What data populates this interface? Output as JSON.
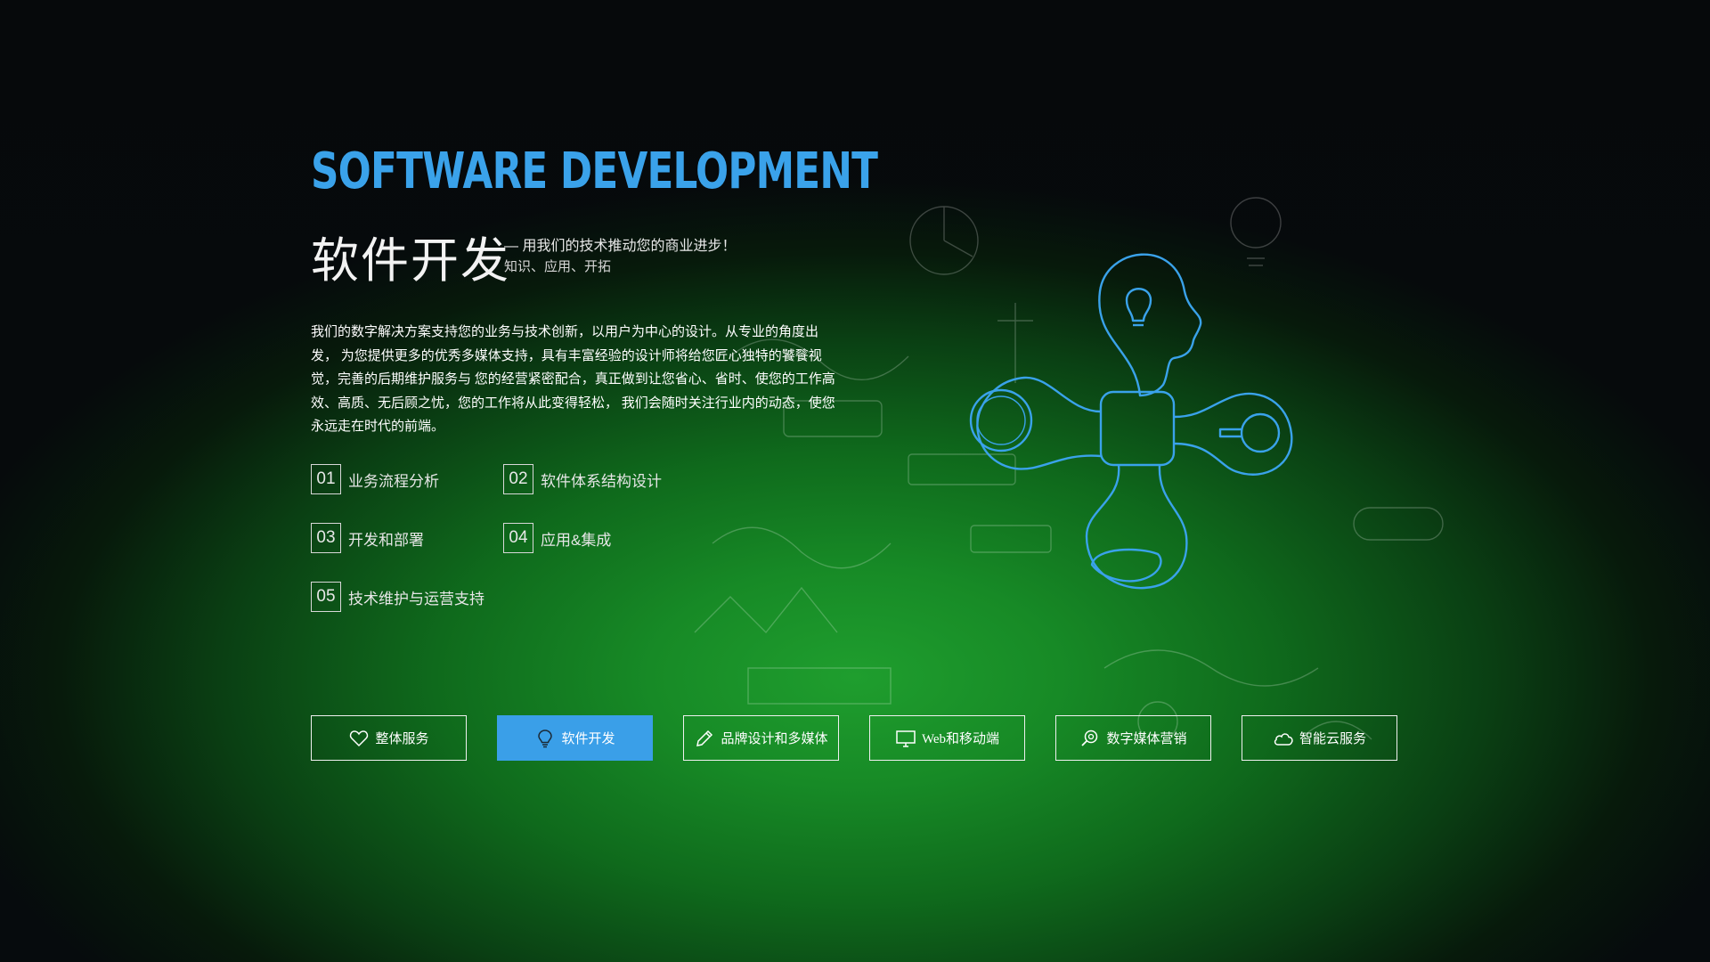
{
  "hero": {
    "headline": "SOFTWARE DEVELOPMENT",
    "title_cn": "软件开发",
    "slogan": "— 用我们的技术推动您的商业进步！",
    "subtags": "知识、应用、开拓",
    "intro": "我们的数字解决方案支持您的业务与技术创新，以用户为中心的设计。从专业的角度出发， 为您提供更多的优秀多媒体支持，具有丰富经验的设计师将给您匠心独特的饕餮视觉，完善的后期维护服务与 您的经营紧密配合，真正做到让您省心、省时、使您的工作高效、高质、无后顾之忧，您的工作将从此变得轻松， 我们会随时关注行业内的动态，使您永远走在时代的前端。"
  },
  "features": [
    {
      "num": "01",
      "label": "业务流程分析"
    },
    {
      "num": "02",
      "label": "软件体系结构设计"
    },
    {
      "num": "03",
      "label": "开发和部署"
    },
    {
      "num": "04",
      "label": "应用&集成"
    },
    {
      "num": "05",
      "label": "技术维护与运营支持"
    }
  ],
  "nav": [
    {
      "label": "整体服务",
      "icon": "heart-icon",
      "active": false
    },
    {
      "label": "软件开发",
      "icon": "lightbulb-icon",
      "active": true
    },
    {
      "label": "品牌设计和多媒体",
      "icon": "pencil-icon",
      "active": false
    },
    {
      "label": "Web和移动端",
      "icon": "monitor-icon",
      "active": false
    },
    {
      "label": "数字媒体营销",
      "icon": "search-icon",
      "active": false
    },
    {
      "label": "智能云服务",
      "icon": "cloud-icon",
      "active": false
    }
  ],
  "colors": {
    "accent": "#3a9fe8",
    "headline": "#3aa2ea",
    "glow": "#1f9e2e",
    "background": "#060b0d"
  }
}
